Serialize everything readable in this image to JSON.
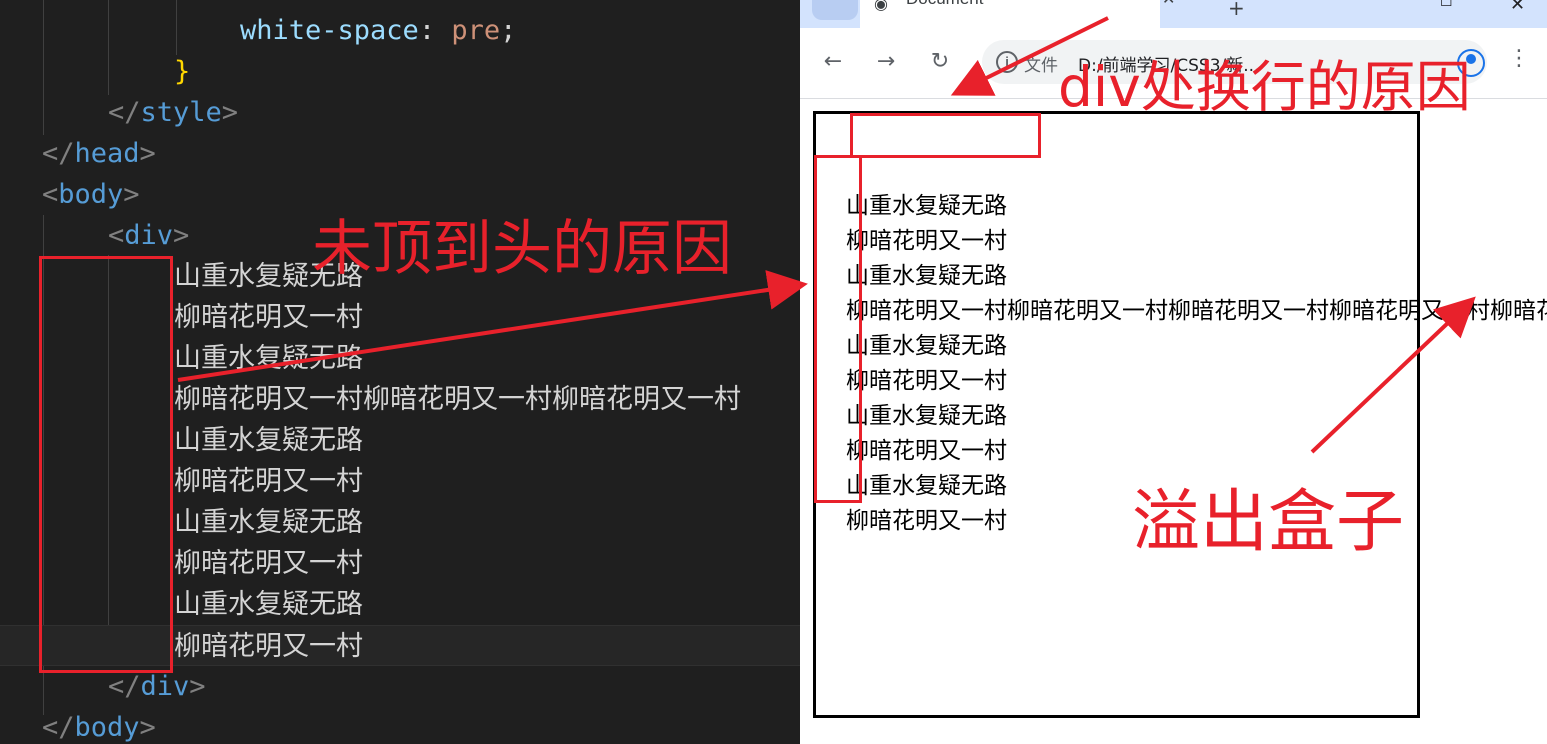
{
  "editor": {
    "lines": {
      "ws_prop": "white-space",
      "ws_colon": ": ",
      "ws_value": "pre",
      "ws_semi": ";",
      "brace": "}",
      "style_tag": "style",
      "head_tag": "head",
      "body_tag": "body",
      "div_tag": "div"
    },
    "content_lines": [
      "山重水复疑无路",
      "柳暗花明又一村",
      "山重水复疑无路",
      "柳暗花明又一村柳暗花明又一村柳暗花明又一村",
      "山重水复疑无路",
      "柳暗花明又一村",
      "山重水复疑无路",
      "柳暗花明又一村",
      "山重水复疑无路",
      "柳暗花明又一村"
    ]
  },
  "browser": {
    "tab_title": "Document",
    "tab_close": "✕",
    "newtab": "+",
    "omnibox": {
      "file_label": "文件",
      "url": "D:/前端学习/CSS3/新..."
    },
    "page_text": "\n山重水复疑无路\n柳暗花明又一村\n山重水复疑无路\n柳暗花明又一村柳暗花明又一村柳暗花明又一村柳暗花明又一村柳暗花明又一村\n山重水复疑无路\n柳暗花明又一村\n山重水复疑无路\n柳暗花明又一村\n山重水复疑无路\n柳暗花明又一村"
  },
  "annotations": {
    "not_to_edge": "未顶到头的原因",
    "div_newline": "div处换行的原因",
    "overflow": "溢出盒子"
  },
  "colors": {
    "annotation_red": "#e8212b",
    "editor_bg": "#1f1f1f",
    "tag_blue": "#569cd6",
    "property_lightblue": "#9cdcfe",
    "value_orange": "#ce9178"
  }
}
